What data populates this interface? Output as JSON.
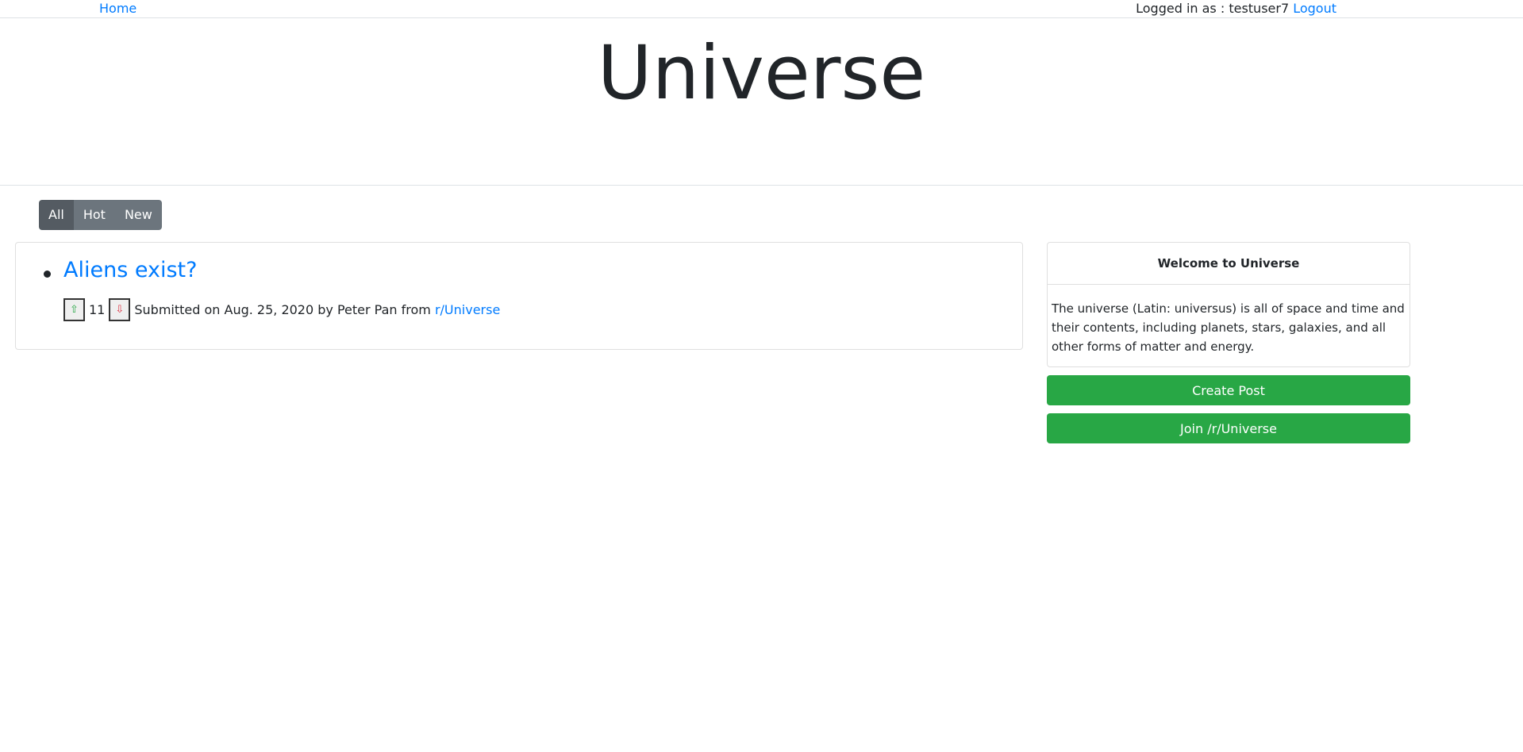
{
  "nav": {
    "home": "Home",
    "logged_in_as": "Logged in as : testuser7",
    "logout": "Logout"
  },
  "banner": {
    "title": "Universe"
  },
  "sort_tabs": [
    {
      "label": "All",
      "active": true
    },
    {
      "label": "Hot",
      "active": false
    },
    {
      "label": "New",
      "active": false
    }
  ],
  "posts": [
    {
      "title": "Aliens exist?",
      "score": "11",
      "submitted": "Submitted on Aug. 25, 2020 by Peter Pan from",
      "community": "r/Universe",
      "upvote_icon": "⇧",
      "downvote_icon": "⇩"
    }
  ],
  "sidebar": {
    "header": "Welcome to Universe",
    "description": "The universe (Latin: universus) is all of space and time and their contents, including planets, stars, galaxies, and all other forms of matter and energy.",
    "create_post": "Create Post",
    "join": "Join /r/Universe"
  },
  "colors": {
    "link": "#007bff",
    "success": "#28a745",
    "secondary": "#6c757d",
    "secondary_active": "#545b62"
  }
}
